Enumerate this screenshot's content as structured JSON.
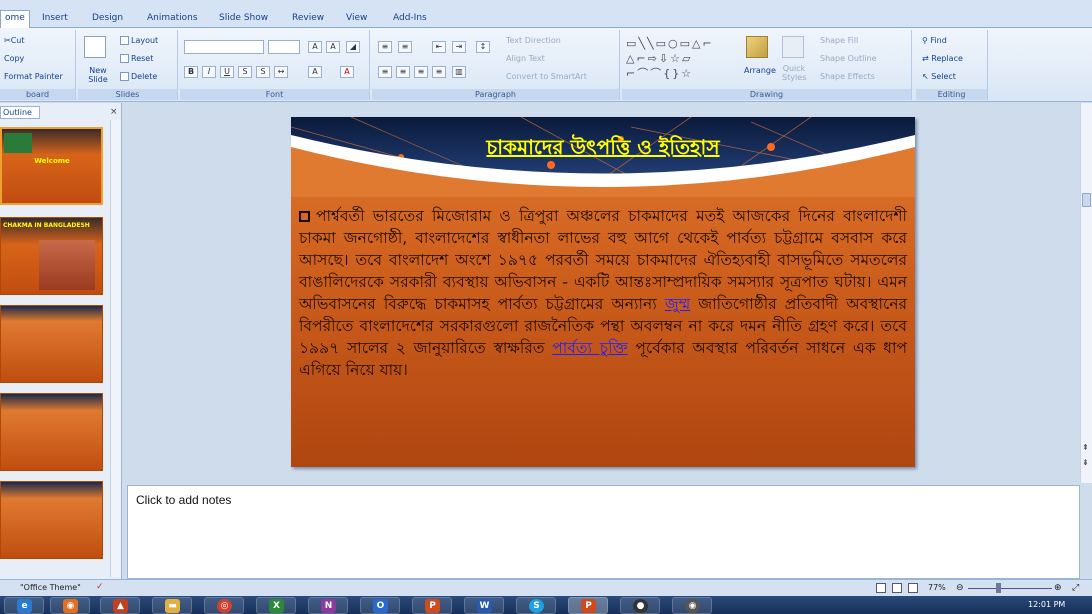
{
  "ribbon_tabs": [
    "ome",
    "Insert",
    "Design",
    "Animations",
    "Slide Show",
    "Review",
    "View",
    "Add-Ins"
  ],
  "clipboard": {
    "cut": "Cut",
    "copy": "Copy",
    "format_painter": "Format Painter",
    "label": "board"
  },
  "slides_group": {
    "new_slide": "New Slide",
    "layout": "Layout",
    "reset": "Reset",
    "delete": "Delete",
    "label": "Slides"
  },
  "font_group": {
    "label": "Font"
  },
  "paragraph_group": {
    "text_direction": "Text Direction",
    "align_text": "Align Text",
    "convert_smartart": "Convert to SmartArt",
    "label": "Paragraph"
  },
  "drawing_group": {
    "arrange": "Arrange",
    "quick_styles": "Quick Styles",
    "shape_fill": "Shape Fill",
    "shape_outline": "Shape Outline",
    "shape_effects": "Shape Effects",
    "label": "Drawing"
  },
  "editing_group": {
    "find": "Find",
    "replace": "Replace",
    "select": "Select",
    "label": "Editing"
  },
  "left_pane": {
    "outline_tab": "Outline"
  },
  "slide": {
    "title": "চাকমাদের উৎপত্তি ও ইতিহাস",
    "body_part1": "পার্শ্ববর্তী ভারতের মিজোরাম ও ত্রিপুরা অঞ্চলের চাকমাদের মতই আজকের দিনের বাংলাদেশী চাকমা জনগোষ্ঠী, বাংলাদেশের স্বাধীনতা লাভের বহু আগে থেকেই পার্বত্য চট্টগ্রামে বসবাস করে আসছে। তবে বাংলাদেশ অংশে ১৯৭৫ পরবর্তী সময়ে চাকমাদের ঐতিহ্যবাহী বাসভূমিতে সমতলের বাঙালিদেরকে সরকারী ব্যবস্থায় অভিবাসন - একটি আন্তঃসাম্প্রদায়িক সমস্যার সূত্রপাত ঘটায়। এমন অভিবাসনের বিরুদ্ধে চাকমাসহ পার্বত্য চট্টগ্রামের অন্যান্য ",
    "link1": "জুম্ম",
    "body_part2": " জাতিগোষ্ঠীর প্রতিবাদী অবস্থানের বিপরীতে বাংলাদেশের সরকারগুলো রাজনৈতিক পন্থা অবলম্বন না করে দমন নীতি গ্রহণ করে। তবে ১৯৯৭ সালের ২ জানুয়ারিতে স্বাক্ষরিত ",
    "link2": "পার্বত্য চুক্তি",
    "body_part3": " পূর্বেকার অবস্থার পরিবর্তন সাধনে এক ধাপ এগিয়ে নিয়ে যায়।"
  },
  "thumbs": [
    {
      "num": "",
      "caption": "Welcome"
    },
    {
      "num": "",
      "caption": "CHAKMA IN BANGLADESH"
    },
    {
      "num": "",
      "caption": ""
    },
    {
      "num": "",
      "caption": ""
    },
    {
      "num": "",
      "caption": ""
    }
  ],
  "notes": {
    "placeholder": "Click to add notes"
  },
  "status": {
    "theme": "\"Office Theme\"",
    "zoom": "77%"
  },
  "clock": "12:01 PM",
  "colors": {
    "slide_orange": "#d0611e",
    "title_yellow": "#ffff00",
    "link_blue": "#2020ff",
    "ribbon_bg": "#dbe7f5"
  }
}
